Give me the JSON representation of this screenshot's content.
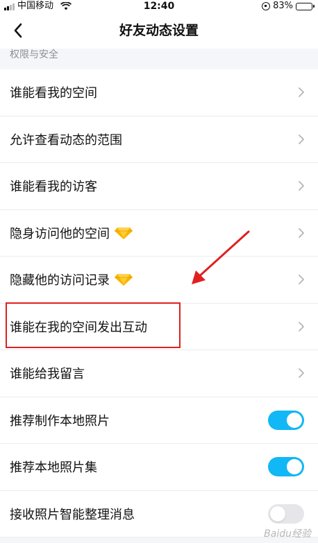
{
  "status_bar": {
    "carrier": "中国移动",
    "time": "12:40",
    "battery_percent": "83%",
    "battery_level": 0.83
  },
  "nav": {
    "title": "好友动态设置",
    "back_icon": "chevron-left-icon"
  },
  "section": {
    "header": "权限与安全"
  },
  "rows": [
    {
      "label": "谁能看我的空间",
      "type": "link"
    },
    {
      "label": "允许查看动态的范围",
      "type": "link"
    },
    {
      "label": "谁能看我的访客",
      "type": "link"
    },
    {
      "label": "隐身访问他的空间",
      "type": "link",
      "vip": true
    },
    {
      "label": "隐藏他的访问记录",
      "type": "link",
      "vip": true
    },
    {
      "label": "谁能在我的空间发出互动",
      "type": "link",
      "highlighted": true
    },
    {
      "label": "谁能给我留言",
      "type": "link"
    },
    {
      "label": "推荐制作本地照片",
      "type": "toggle",
      "on": true
    },
    {
      "label": "推荐本地照片集",
      "type": "toggle",
      "on": true
    },
    {
      "label": "接收照片智能整理消息",
      "type": "toggle",
      "on": false
    }
  ],
  "colors": {
    "toggle_on": "#12b7f5",
    "toggle_off": "#e6e6ea",
    "highlight": "#e02020",
    "vip_gem": "#f7b500"
  },
  "watermark": "Baidu经验"
}
